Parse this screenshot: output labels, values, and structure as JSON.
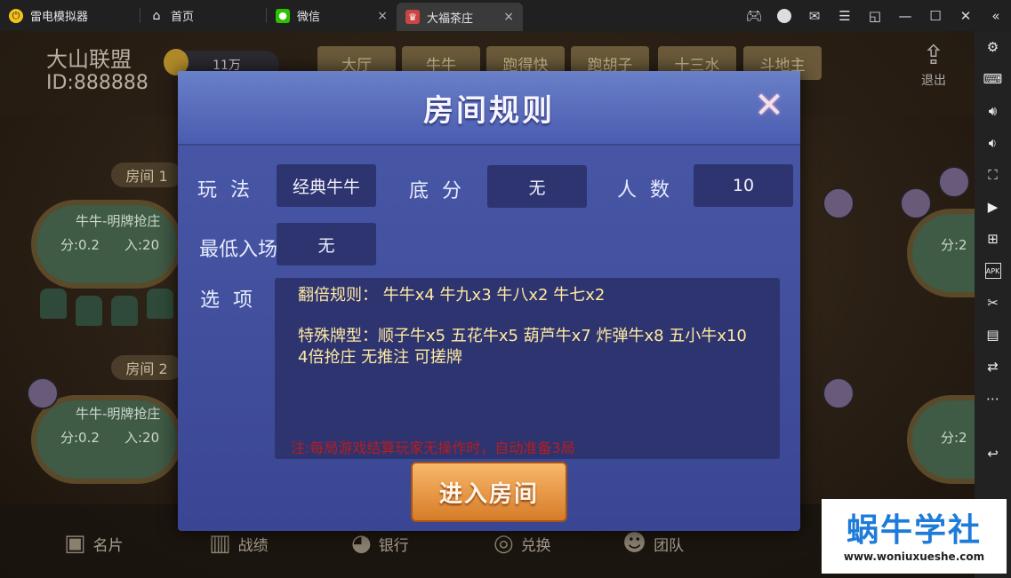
{
  "titlebar": {
    "app_name": "雷电模拟器",
    "tabs": [
      {
        "label": "首页"
      },
      {
        "label": "微信"
      },
      {
        "label": "大福茶庄"
      }
    ],
    "tab_close": "×"
  },
  "lobby": {
    "club_name": "大山联盟",
    "club_id": "ID:888888",
    "coins": "11万",
    "game_tabs": [
      "大厅",
      "牛牛",
      "跑得快",
      "跑胡子",
      "十三水",
      "斗地主"
    ],
    "exit_label": "退出",
    "rooms": [
      {
        "label": "房间 1",
        "title": "牛牛-明牌抢庄",
        "score": "分:0.2",
        "entry": "入:20"
      },
      {
        "label": "房间 2",
        "title": "牛牛-明牌抢庄",
        "score": "分:0.2",
        "entry": "入:20"
      }
    ],
    "right_tables": [
      {
        "score": "分:2"
      },
      {
        "score": "分:2"
      }
    ],
    "bottom_nav": [
      "名片",
      "战绩",
      "银行",
      "兑换",
      "团队"
    ]
  },
  "modal": {
    "title": "房间规则",
    "close": "✕",
    "fields": {
      "mode_label": "玩 法",
      "mode_value": "经典牛牛",
      "base_label": "底 分",
      "base_value": "无",
      "players_label": "人 数",
      "players_value": "10",
      "min_entry_label": "最低入场",
      "min_entry_value": "无",
      "options_label": "选 项"
    },
    "options": {
      "double_rules": "翻倍规则： 牛牛x4 牛九x3 牛八x2 牛七x2",
      "special_types": "特殊牌型：顺子牛x5 五花牛x5 葫芦牛x7 炸弹牛x8 五小牛x10",
      "extra": "4倍抢庄 无推注 可搓牌",
      "note": "注:每局游戏结算玩家无操作时，自动准备3局"
    },
    "enter_button": "进入房间"
  },
  "watermark": {
    "title": "蜗牛学社",
    "url": "www.woniuxueshe.com"
  }
}
